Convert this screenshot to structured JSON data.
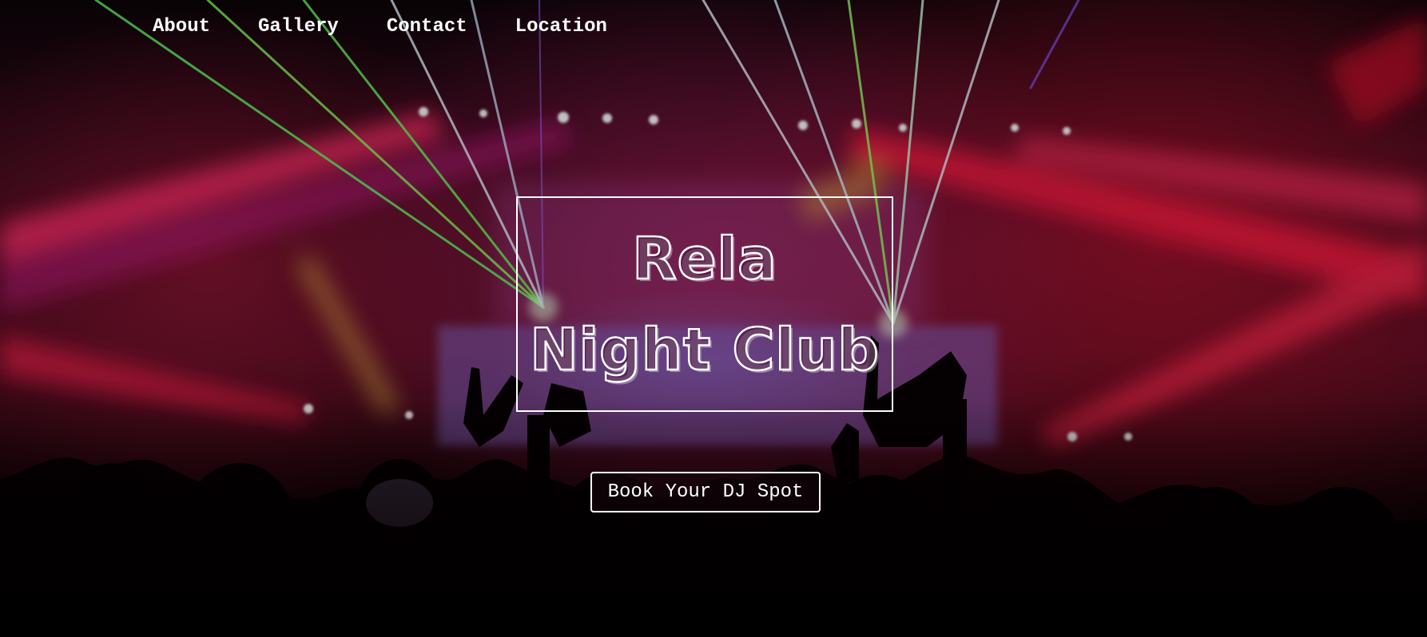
{
  "nav": {
    "items": [
      {
        "label": "About"
      },
      {
        "label": "Gallery"
      },
      {
        "label": "Contact"
      },
      {
        "label": "Location"
      }
    ]
  },
  "hero": {
    "title_line_1": "Rela",
    "title_line_2": "Night Club",
    "cta_label": "Book Your DJ Spot",
    "background_description_colors": {
      "primary": "#c0143c",
      "secondary": "#a01e78",
      "laser_green": "#7cff6a",
      "laser_white": "#e8f4ff"
    },
    "hero_image_icon": "concert-crowd-laser-image"
  }
}
